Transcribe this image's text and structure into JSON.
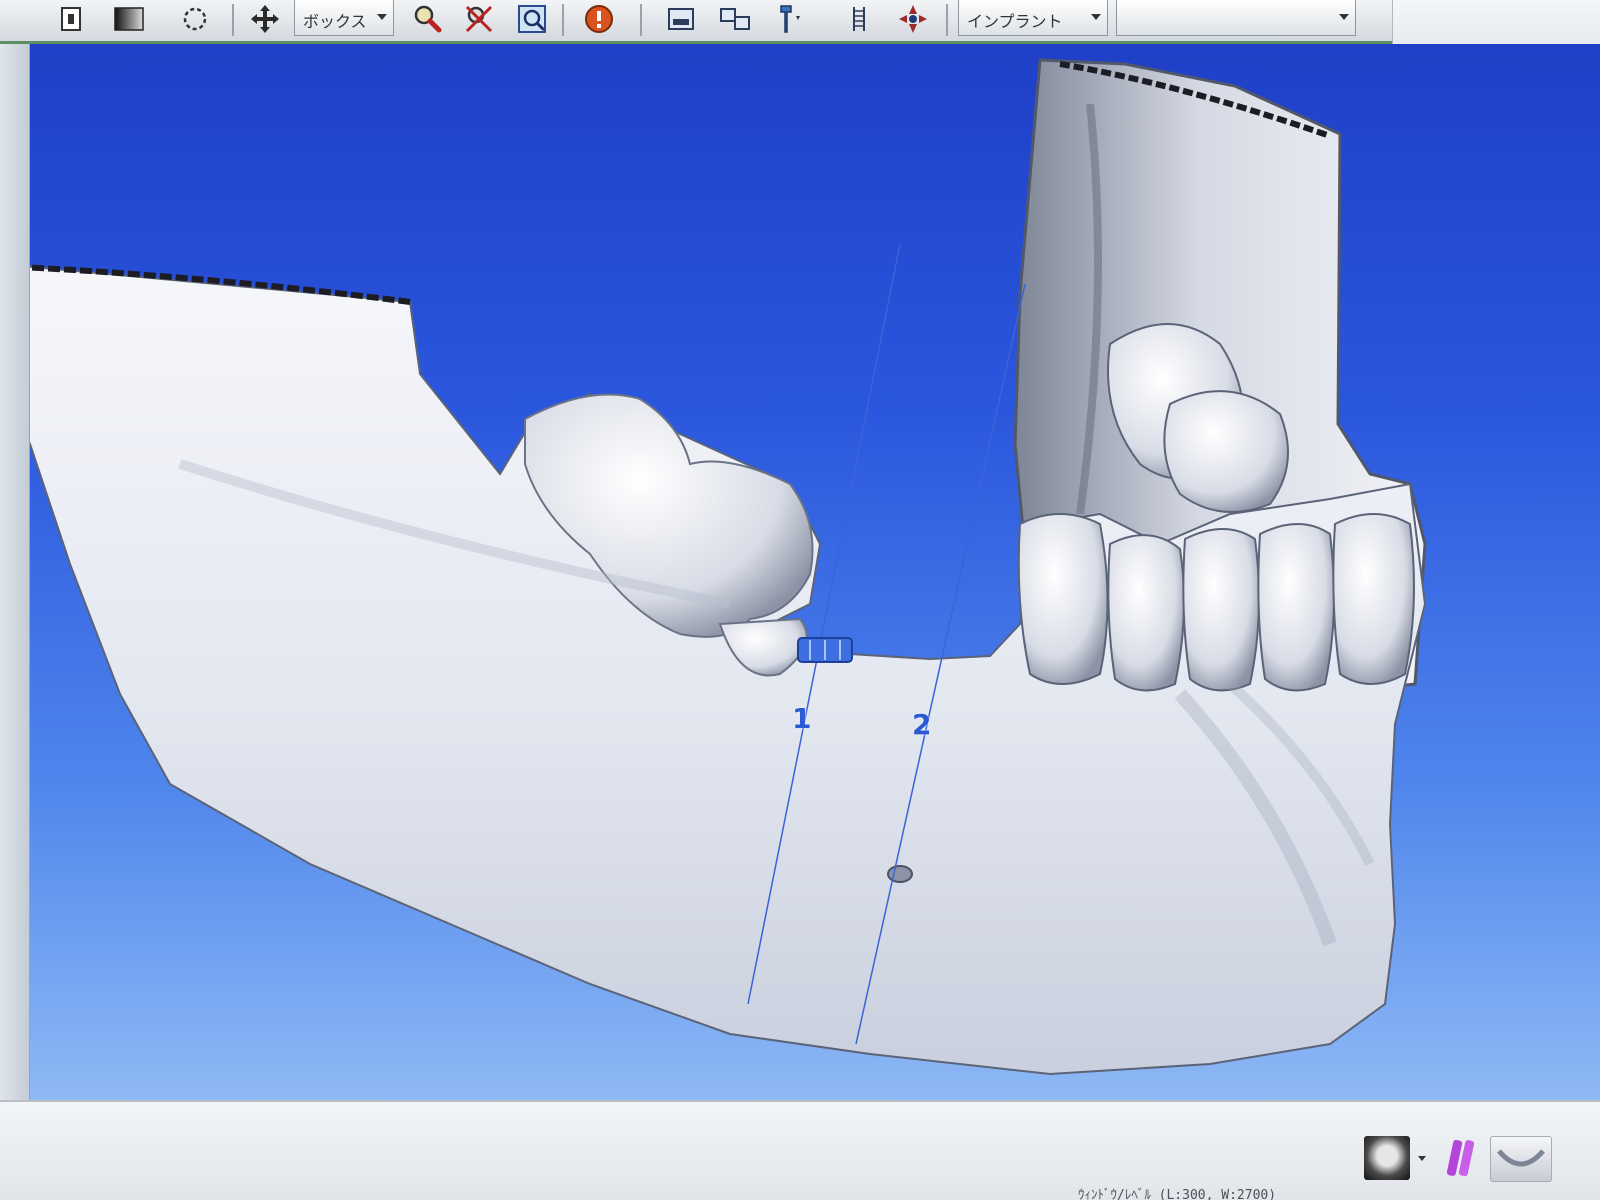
{
  "toolbar": {
    "view_mode_select": "ボックス",
    "mode_select": "インプラント",
    "secondary_select": "",
    "icons": [
      "page-icon",
      "brightness-icon",
      "rotate-icon",
      "move-icon",
      "zoom-icon",
      "zoom-reset-icon",
      "zoom-window-icon",
      "info-icon",
      "layout-1-icon",
      "layout-2-icon",
      "implant-tool-icon",
      "ruler-icon",
      "navigation-icon"
    ]
  },
  "viewport": {
    "scene": "3d-mandible-render",
    "markers": [
      {
        "label": "1"
      },
      {
        "label": "2"
      }
    ],
    "colors": {
      "background_top": "#1f3fc7",
      "background_bottom": "#8fb9f5",
      "bone": "#e9ecf4",
      "marker": "#2a5bd3"
    }
  },
  "bottom_bar": {
    "thumbnails": [
      "skull-thumbnail-icon",
      "implant-thumbnail-icon",
      "jaw-thumbnail-icon"
    ],
    "status": "ｳｨﾝﾄﾞｳ/ﾚﾍﾞﾙ (L:300, W:2700)"
  }
}
